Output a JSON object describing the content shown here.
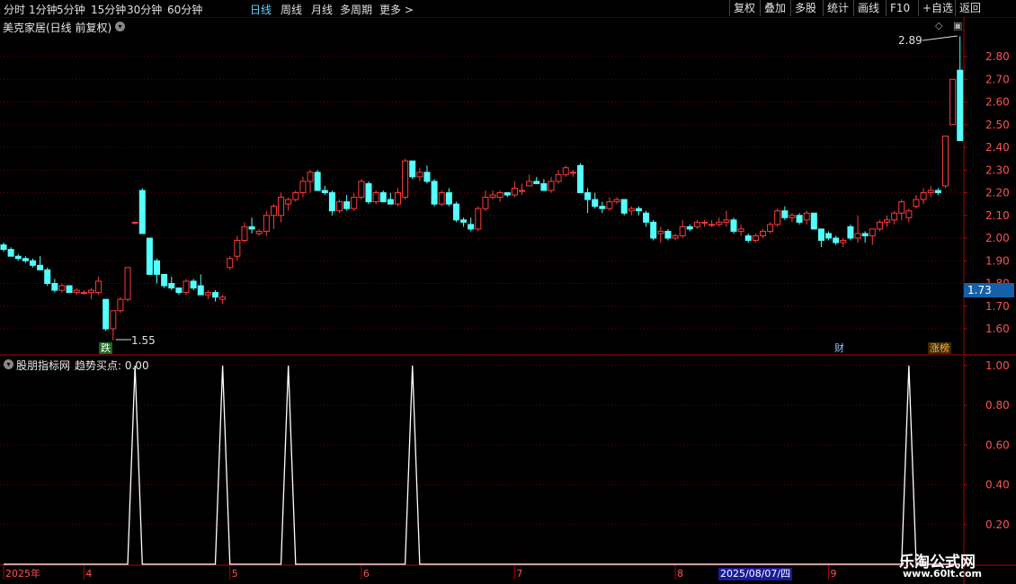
{
  "toolbar": {
    "timeframes": [
      "分时",
      "1分钟",
      "5分钟",
      "15分钟",
      "30分钟",
      "60分钟",
      "日线",
      "周线",
      "月线",
      "多周期",
      "更多 >"
    ],
    "active_timeframe": "日线",
    "right_buttons": [
      "复权",
      "叠加",
      "多股",
      "统计",
      "画线",
      "F10",
      "+自选",
      "返回"
    ],
    "active_color": "#5fd6ff"
  },
  "main_panel": {
    "title": "美克家居(日线 前复权)",
    "current_price_label": "1.73",
    "high_annotation": "2.89",
    "low_annotation": "1.55",
    "badges": {
      "die": "跌",
      "cai": "财",
      "zhangting": "涨榜"
    }
  },
  "indicator_panel": {
    "title": "股朋指标网",
    "value_label": "趋势买点: 0.00"
  },
  "x_axis": {
    "labels": [
      "2025年",
      "4",
      "5",
      "6",
      "7",
      "8",
      "9"
    ],
    "cursor_date": "2025/08/07/四"
  },
  "watermark": {
    "name": "乐淘公式网",
    "url": "www.60lt.com"
  },
  "chart_data": [
    {
      "type": "candlestick",
      "title": "",
      "y_ticks": [
        1.6,
        1.7,
        1.8,
        1.9,
        2.0,
        2.1,
        2.2,
        2.3,
        2.4,
        2.5,
        2.6,
        2.7,
        2.8
      ],
      "ylim": [
        1.53,
        2.93
      ],
      "up_color": "#ff3b3b",
      "down_color": "#54ffff",
      "ohlc": [
        [
          1.97,
          1.98,
          1.94,
          1.95
        ],
        [
          1.95,
          1.96,
          1.92,
          1.92
        ],
        [
          1.92,
          1.93,
          1.9,
          1.91
        ],
        [
          1.91,
          1.92,
          1.89,
          1.9
        ],
        [
          1.9,
          1.91,
          1.87,
          1.88
        ],
        [
          1.88,
          1.92,
          1.86,
          1.86
        ],
        [
          1.86,
          1.87,
          1.79,
          1.8
        ],
        [
          1.8,
          1.82,
          1.76,
          1.77
        ],
        [
          1.77,
          1.8,
          1.76,
          1.79
        ],
        [
          1.79,
          1.79,
          1.76,
          1.76
        ],
        [
          1.76,
          1.78,
          1.75,
          1.77
        ],
        [
          1.76,
          1.77,
          1.75,
          1.76
        ],
        [
          1.76,
          1.78,
          1.73,
          1.77
        ],
        [
          1.76,
          1.83,
          1.75,
          1.81
        ],
        [
          1.73,
          1.73,
          1.59,
          1.6
        ],
        [
          1.6,
          1.68,
          1.55,
          1.68
        ],
        [
          1.68,
          1.74,
          1.67,
          1.73
        ],
        [
          1.73,
          1.87,
          1.72,
          1.87
        ],
        [
          2.07,
          2.07,
          2.06,
          2.07
        ],
        [
          2.21,
          2.22,
          2.02,
          2.02
        ],
        [
          2.0,
          2.0,
          1.84,
          1.84
        ],
        [
          1.9,
          1.91,
          1.8,
          1.84
        ],
        [
          1.84,
          1.84,
          1.78,
          1.79
        ],
        [
          1.8,
          1.83,
          1.77,
          1.78
        ],
        [
          1.78,
          1.78,
          1.75,
          1.76
        ],
        [
          1.76,
          1.82,
          1.75,
          1.81
        ],
        [
          1.81,
          1.82,
          1.77,
          1.78
        ],
        [
          1.79,
          1.84,
          1.76,
          1.75
        ],
        [
          1.75,
          1.77,
          1.73,
          1.76
        ],
        [
          1.76,
          1.77,
          1.72,
          1.74
        ],
        [
          1.73,
          1.75,
          1.71,
          1.74
        ],
        [
          1.87,
          1.92,
          1.86,
          1.91
        ],
        [
          1.92,
          2.01,
          1.9,
          1.99
        ],
        [
          1.99,
          2.07,
          1.98,
          2.05
        ],
        [
          2.05,
          2.09,
          2.02,
          2.04
        ],
        [
          2.02,
          2.04,
          2.01,
          2.03
        ],
        [
          2.03,
          2.12,
          2.01,
          2.1
        ],
        [
          2.1,
          2.15,
          2.04,
          2.14
        ],
        [
          2.1,
          2.2,
          2.07,
          2.18
        ],
        [
          2.15,
          2.18,
          2.12,
          2.17
        ],
        [
          2.17,
          2.21,
          2.16,
          2.2
        ],
        [
          2.2,
          2.27,
          2.18,
          2.25
        ],
        [
          2.25,
          2.3,
          2.2,
          2.29
        ],
        [
          2.29,
          2.3,
          2.25,
          2.21
        ],
        [
          2.21,
          2.23,
          2.19,
          2.2
        ],
        [
          2.2,
          2.21,
          2.1,
          2.12
        ],
        [
          2.12,
          2.17,
          2.11,
          2.16
        ],
        [
          2.16,
          2.19,
          2.12,
          2.13
        ],
        [
          2.13,
          2.2,
          2.12,
          2.18
        ],
        [
          2.18,
          2.26,
          2.17,
          2.25
        ],
        [
          2.24,
          2.25,
          2.15,
          2.16
        ],
        [
          2.16,
          2.21,
          2.15,
          2.2
        ],
        [
          2.2,
          2.21,
          2.17,
          2.16
        ],
        [
          2.17,
          2.2,
          2.16,
          2.15
        ],
        [
          2.15,
          2.22,
          2.14,
          2.2
        ],
        [
          2.18,
          2.35,
          2.17,
          2.34
        ],
        [
          2.34,
          2.33,
          2.26,
          2.27
        ],
        [
          2.27,
          2.31,
          2.25,
          2.29
        ],
        [
          2.29,
          2.32,
          2.24,
          2.25
        ],
        [
          2.25,
          2.26,
          2.14,
          2.15
        ],
        [
          2.15,
          2.21,
          2.14,
          2.2
        ],
        [
          2.2,
          2.22,
          2.14,
          2.15
        ],
        [
          2.15,
          2.16,
          2.07,
          2.08
        ],
        [
          2.08,
          2.09,
          2.05,
          2.07
        ],
        [
          2.06,
          2.09,
          2.03,
          2.04
        ],
        [
          2.04,
          2.14,
          2.03,
          2.13
        ],
        [
          2.13,
          2.21,
          2.12,
          2.18
        ],
        [
          2.18,
          2.21,
          2.17,
          2.19
        ],
        [
          2.18,
          2.21,
          2.16,
          2.2
        ],
        [
          2.2,
          2.2,
          2.18,
          2.19
        ],
        [
          2.19,
          2.25,
          2.18,
          2.22
        ],
        [
          2.21,
          2.24,
          2.19,
          2.21
        ],
        [
          2.23,
          2.28,
          2.23,
          2.25
        ],
        [
          2.25,
          2.27,
          2.24,
          2.24
        ],
        [
          2.24,
          2.26,
          2.21,
          2.21
        ],
        [
          2.21,
          2.27,
          2.2,
          2.25
        ],
        [
          2.25,
          2.3,
          2.24,
          2.28
        ],
        [
          2.28,
          2.32,
          2.27,
          2.31
        ],
        [
          2.29,
          2.3,
          2.27,
          2.29
        ],
        [
          2.32,
          2.33,
          2.2,
          2.2
        ],
        [
          2.2,
          2.22,
          2.11,
          2.17
        ],
        [
          2.17,
          2.2,
          2.13,
          2.14
        ],
        [
          2.14,
          2.16,
          2.11,
          2.13
        ],
        [
          2.13,
          2.18,
          2.12,
          2.16
        ],
        [
          2.16,
          2.18,
          2.15,
          2.17
        ],
        [
          2.17,
          2.17,
          2.1,
          2.11
        ],
        [
          2.12,
          2.14,
          2.1,
          2.13
        ],
        [
          2.13,
          2.14,
          2.1,
          2.12
        ],
        [
          2.11,
          2.12,
          2.05,
          2.07
        ],
        [
          2.07,
          2.08,
          1.99,
          2.0
        ],
        [
          2.02,
          2.05,
          1.98,
          2.03
        ],
        [
          2.03,
          2.04,
          1.99,
          2.0
        ],
        [
          2.0,
          2.02,
          1.99,
          2.01
        ],
        [
          2.01,
          2.08,
          2.0,
          2.05
        ],
        [
          2.05,
          2.06,
          2.03,
          2.04
        ],
        [
          2.05,
          2.08,
          2.04,
          2.07
        ],
        [
          2.07,
          2.08,
          2.05,
          2.07
        ],
        [
          2.06,
          2.08,
          2.05,
          2.06
        ],
        [
          2.06,
          2.09,
          2.05,
          2.07
        ],
        [
          2.07,
          2.12,
          2.05,
          2.08
        ],
        [
          2.08,
          2.09,
          2.02,
          2.03
        ],
        [
          2.03,
          2.06,
          2.01,
          2.04
        ],
        [
          2.01,
          2.02,
          1.98,
          1.99
        ],
        [
          1.99,
          2.02,
          1.98,
          2.01
        ],
        [
          2.01,
          2.04,
          2.0,
          2.03
        ],
        [
          2.03,
          2.07,
          2.02,
          2.06
        ],
        [
          2.06,
          2.13,
          2.05,
          2.12
        ],
        [
          2.12,
          2.14,
          2.08,
          2.09
        ],
        [
          2.09,
          2.11,
          2.07,
          2.1
        ],
        [
          2.1,
          2.11,
          2.06,
          2.07
        ],
        [
          2.08,
          2.12,
          2.06,
          2.11
        ],
        [
          2.11,
          2.11,
          2.04,
          2.04
        ],
        [
          2.04,
          2.04,
          1.96,
          1.99
        ],
        [
          2.02,
          2.03,
          1.99,
          2.0
        ],
        [
          2.0,
          2.01,
          1.97,
          1.98
        ],
        [
          1.98,
          2.0,
          1.96,
          1.99
        ],
        [
          2.05,
          2.06,
          1.99,
          2.0
        ],
        [
          2.0,
          2.1,
          1.98,
          2.02
        ],
        [
          2.02,
          2.03,
          1.98,
          2.01
        ],
        [
          2.01,
          2.03,
          1.97,
          2.04
        ],
        [
          2.04,
          2.08,
          2.03,
          2.07
        ],
        [
          2.07,
          2.1,
          2.05,
          2.08
        ],
        [
          2.08,
          2.12,
          2.06,
          2.11
        ],
        [
          2.11,
          2.17,
          2.08,
          2.16
        ],
        [
          2.09,
          2.13,
          2.07,
          2.12
        ],
        [
          2.14,
          2.19,
          2.13,
          2.17
        ],
        [
          2.17,
          2.22,
          2.15,
          2.2
        ],
        [
          2.2,
          2.23,
          2.18,
          2.21
        ],
        [
          2.21,
          2.22,
          2.19,
          2.2
        ],
        [
          2.23,
          2.45,
          2.22,
          2.45
        ],
        [
          2.5,
          2.7,
          2.5,
          2.7
        ],
        [
          2.74,
          2.89,
          2.43,
          2.43
        ]
      ]
    },
    {
      "type": "line",
      "title": "",
      "series": [
        {
          "name": "趋势买点",
          "spikes_at_index": [
            18,
            30,
            39,
            56,
            124
          ]
        }
      ],
      "y_ticks": [
        0.2,
        0.4,
        0.6,
        0.8,
        1.0
      ],
      "ylim": [
        0,
        1.04
      ],
      "line_color": "#ffffff"
    }
  ]
}
